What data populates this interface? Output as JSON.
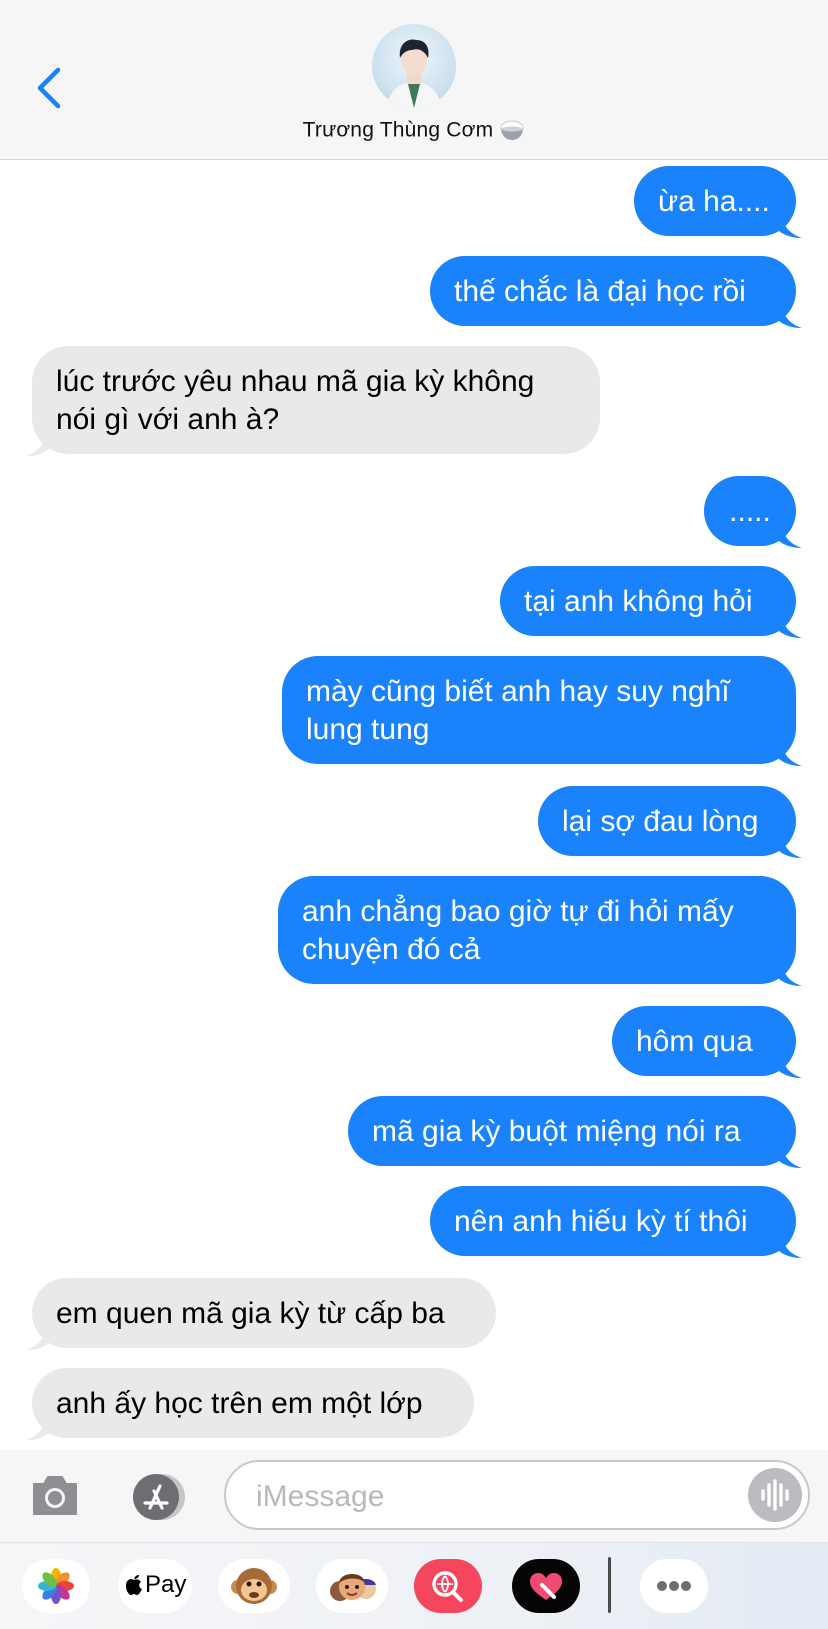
{
  "header": {
    "contact_name": "Trương Thùng Cơm",
    "icons": [
      "back-chevron-icon",
      "contact-avatar",
      "rice-bowl-emoji"
    ]
  },
  "messages": [
    {
      "dir": "out",
      "text": "ừa ha...."
    },
    {
      "dir": "out",
      "text": "thế chắc là đại học rồi"
    },
    {
      "dir": "in",
      "text": "lúc trước yêu nhau mã gia kỳ không nói gì với anh à?"
    },
    {
      "dir": "out",
      "text": "....."
    },
    {
      "dir": "out",
      "text": "tại anh không hỏi"
    },
    {
      "dir": "out",
      "text": "mày cũng biết anh hay suy nghĩ lung tung"
    },
    {
      "dir": "out",
      "text": "lại sợ đau lòng"
    },
    {
      "dir": "out",
      "text": "anh chẳng bao giờ tự đi hỏi mấy chuyện đó cả"
    },
    {
      "dir": "out",
      "text": "hôm qua"
    },
    {
      "dir": "out",
      "text": "mã gia kỳ buột miệng nói ra"
    },
    {
      "dir": "out",
      "text": "nên anh hiếu kỳ tí thôi"
    },
    {
      "dir": "in",
      "text": "em quen mã gia kỳ từ cấp ba"
    },
    {
      "dir": "in",
      "text": "anh ấy học trên em một lớp"
    }
  ],
  "input": {
    "placeholder": "iMessage"
  },
  "apps": {
    "apple_pay_label": "Pay",
    "items": [
      "photos-icon",
      "apple-pay-icon",
      "monkey-memoji-icon",
      "memoji-stickers-icon",
      "image-search-icon",
      "digital-touch-icon",
      "more-icon"
    ]
  },
  "colors": {
    "outgoing": "#1a82fb",
    "incoming": "#e9e9eb",
    "accent": "#1a82fb",
    "header_bg": "#f6f6f6"
  }
}
